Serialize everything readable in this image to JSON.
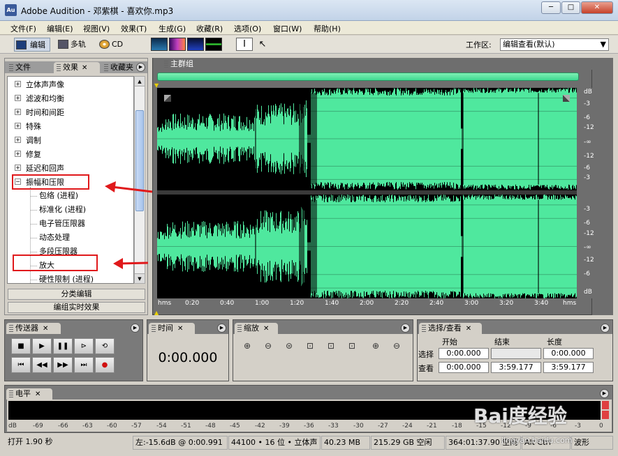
{
  "window": {
    "title": "Adobe Audition - 邓紫棋 - 喜欢你.mp3",
    "icon_label": "Au",
    "min": "─",
    "max": "□",
    "close": "✕"
  },
  "menu": [
    "文件(F)",
    "编辑(E)",
    "视图(V)",
    "效果(T)",
    "生成(G)",
    "收藏(R)",
    "选项(O)",
    "窗口(W)",
    "帮助(H)"
  ],
  "toolbar": {
    "edit": "编辑",
    "multitrack": "多轨",
    "cd": "CD",
    "workspace_label": "工作区:",
    "workspace_value": "编辑查看(默认)"
  },
  "left_panel": {
    "tabs": [
      "文件",
      "效果",
      "收藏夹"
    ],
    "tree": [
      {
        "label": "立体声声像",
        "expanded": false
      },
      {
        "label": "滤波和均衡",
        "expanded": false
      },
      {
        "label": "时间和间距",
        "expanded": false
      },
      {
        "label": "特殊",
        "expanded": false
      },
      {
        "label": "调制",
        "expanded": false
      },
      {
        "label": "修复",
        "expanded": false
      },
      {
        "label": "延迟和回声",
        "expanded": false
      },
      {
        "label": "振幅和压限",
        "expanded": true
      }
    ],
    "children": [
      "包络 (进程)",
      "标准化 (进程)",
      "电子管压限器",
      "动态处理",
      "多段压限器",
      "放大",
      "硬性限制 (进程)"
    ],
    "btn_group": "分类编辑",
    "btn_realtime": "编组实时效果"
  },
  "main": {
    "tab": "主群组",
    "db_labels_top": [
      "dB",
      "-3",
      "-6",
      "-12",
      "-∞",
      "-12",
      "-6",
      "-3"
    ],
    "db_labels_bottom": [
      "-3",
      "-6",
      "-12",
      "-∞",
      "-12",
      "-6",
      "dB"
    ],
    "time_labels": [
      "hms",
      "0:20",
      "0:40",
      "1:00",
      "1:20",
      "1:40",
      "2:00",
      "2:20",
      "2:40",
      "3:00",
      "3:20",
      "3:40",
      "hms"
    ]
  },
  "transport": {
    "title": "传送器"
  },
  "time": {
    "title": "时间",
    "value": "0:00.000"
  },
  "zoom": {
    "title": "缩放"
  },
  "selection": {
    "title": "选择/查看",
    "col_start": "开始",
    "col_end": "结束",
    "col_length": "长度",
    "row_select": "选择",
    "row_view": "查看",
    "sel_start": "0:00.000",
    "sel_end": "",
    "sel_length": "0:00.000",
    "view_start": "0:00.000",
    "view_end": "3:59.177",
    "view_length": "3:59.177"
  },
  "levels": {
    "title": "电平",
    "scale": [
      "dB",
      "-69",
      "-66",
      "-63",
      "-60",
      "-57",
      "-54",
      "-51",
      "-48",
      "-45",
      "-42",
      "-39",
      "-36",
      "-33",
      "-30",
      "-27",
      "-24",
      "-21",
      "-18",
      "-15",
      "-12",
      "-9",
      "-6",
      "-3",
      "0"
    ]
  },
  "status": {
    "open": "打开 1.90 秒",
    "cursor": "左:-15.6dB @ 0:00.991",
    "format": "44100 • 16 位 • 立体声",
    "size": "40.23 MB",
    "free": "215.29 GB 空闲",
    "free_time": "364:01:37.90 空闲",
    "key": "Alt Ctrl",
    "view": "波形"
  },
  "watermark": {
    "text": "Bai度经验",
    "url": "jingyan.baidu.com"
  }
}
